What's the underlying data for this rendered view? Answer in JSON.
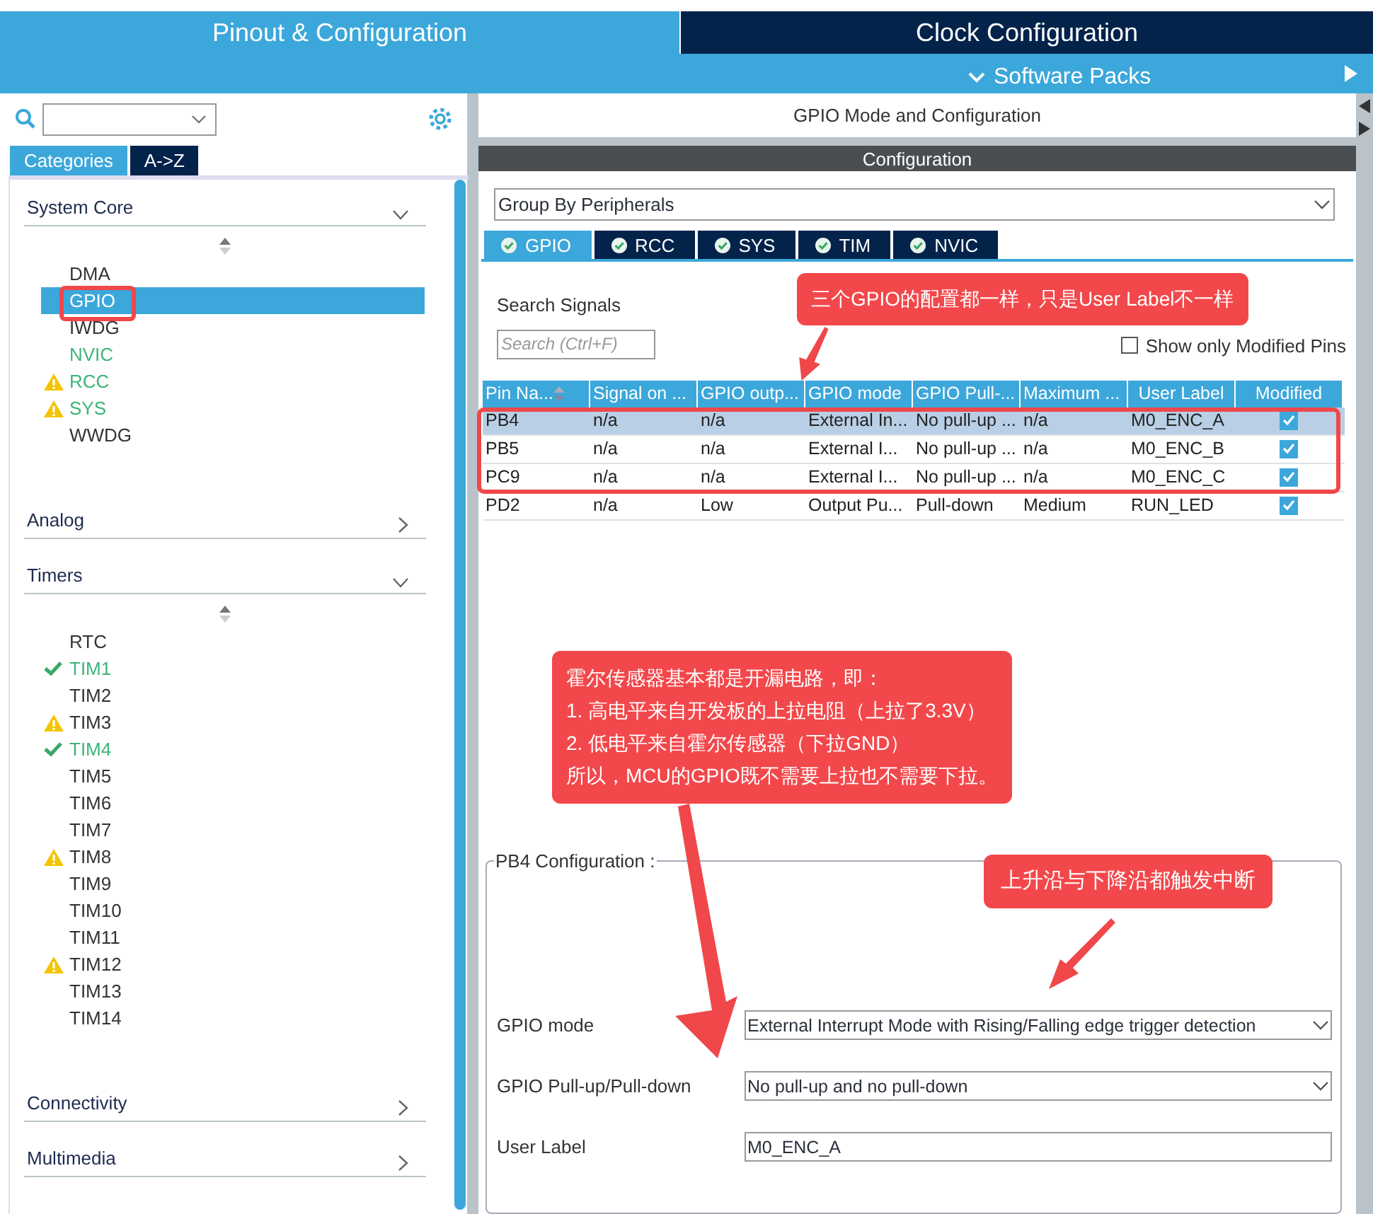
{
  "top_tabs": [
    {
      "label": "Pinout & Configuration",
      "selected": true
    },
    {
      "label": "Clock Configuration",
      "selected": false
    }
  ],
  "toolbar": {
    "menu": "Software Packs"
  },
  "sidebar": {
    "tabs": [
      {
        "label": "Categories",
        "selected": true
      },
      {
        "label": "A->Z",
        "selected": false
      }
    ],
    "categories": [
      {
        "label": "System Core",
        "expanded": true,
        "items": [
          {
            "label": "DMA",
            "kind": "plain",
            "enabled": false,
            "selected": false
          },
          {
            "label": "GPIO",
            "kind": "plain",
            "enabled": false,
            "selected": true
          },
          {
            "label": "IWDG",
            "kind": "plain",
            "enabled": false,
            "selected": false
          },
          {
            "label": "NVIC",
            "kind": "plain",
            "enabled": true,
            "selected": false
          },
          {
            "label": "RCC",
            "kind": "warning",
            "enabled": true,
            "selected": false
          },
          {
            "label": "SYS",
            "kind": "warning",
            "enabled": true,
            "selected": false
          },
          {
            "label": "WWDG",
            "kind": "plain",
            "enabled": false,
            "selected": false
          }
        ]
      },
      {
        "label": "Analog",
        "expanded": false
      },
      {
        "label": "Timers",
        "expanded": true,
        "items": [
          {
            "label": "RTC",
            "kind": "plain",
            "enabled": false,
            "selected": false
          },
          {
            "label": "TIM1",
            "kind": "ok",
            "enabled": true,
            "selected": false
          },
          {
            "label": "TIM2",
            "kind": "plain",
            "enabled": false,
            "selected": false
          },
          {
            "label": "TIM3",
            "kind": "warning",
            "enabled": false,
            "selected": false
          },
          {
            "label": "TIM4",
            "kind": "ok",
            "enabled": true,
            "selected": false
          },
          {
            "label": "TIM5",
            "kind": "plain",
            "enabled": false,
            "selected": false
          },
          {
            "label": "TIM6",
            "kind": "plain",
            "enabled": false,
            "selected": false
          },
          {
            "label": "TIM7",
            "kind": "plain",
            "enabled": false,
            "selected": false
          },
          {
            "label": "TIM8",
            "kind": "warning",
            "enabled": false,
            "selected": false
          },
          {
            "label": "TIM9",
            "kind": "plain",
            "enabled": false,
            "selected": false
          },
          {
            "label": "TIM10",
            "kind": "plain",
            "enabled": false,
            "selected": false
          },
          {
            "label": "TIM11",
            "kind": "plain",
            "enabled": false,
            "selected": false
          },
          {
            "label": "TIM12",
            "kind": "warning",
            "enabled": false,
            "selected": false
          },
          {
            "label": "TIM13",
            "kind": "plain",
            "enabled": false,
            "selected": false
          },
          {
            "label": "TIM14",
            "kind": "plain",
            "enabled": false,
            "selected": false
          }
        ]
      },
      {
        "label": "Connectivity",
        "expanded": false
      },
      {
        "label": "Multimedia",
        "expanded": false
      }
    ]
  },
  "main": {
    "title": "GPIO Mode and Configuration",
    "config_title": "Configuration",
    "group_by": "Group By Peripherals",
    "tabs": [
      {
        "label": "GPIO",
        "selected": true
      },
      {
        "label": "RCC",
        "selected": false
      },
      {
        "label": "SYS",
        "selected": false
      },
      {
        "label": "TIM",
        "selected": false
      },
      {
        "label": "NVIC",
        "selected": false
      }
    ],
    "search_label": "Search Signals",
    "search": {
      "placeholder": "Search (Ctrl+F)"
    },
    "show_modified": {
      "label": "Show only Modified Pins",
      "checked": false
    },
    "table": {
      "columns": [
        "Pin Na...",
        "Signal on ...",
        "GPIO outp...",
        "GPIO mode",
        "GPIO Pull-...",
        "Maximum ...",
        "User Label",
        "Modified"
      ],
      "rows": [
        {
          "cells": [
            "PB4",
            "n/a",
            "n/a",
            "External In...",
            "No pull-up ...",
            "n/a",
            "M0_ENC_A"
          ],
          "modified": true,
          "selected": true
        },
        {
          "cells": [
            "PB5",
            "n/a",
            "n/a",
            "External I...",
            "No pull-up ...",
            "n/a",
            "M0_ENC_B"
          ],
          "modified": true,
          "selected": false
        },
        {
          "cells": [
            "PC9",
            "n/a",
            "n/a",
            "External I...",
            "No pull-up ...",
            "n/a",
            "M0_ENC_C"
          ],
          "modified": true,
          "selected": false
        },
        {
          "cells": [
            "PD2",
            "n/a",
            "Low",
            "Output Pu...",
            "Pull-down",
            "Medium",
            "RUN_LED"
          ],
          "modified": true,
          "selected": false
        }
      ]
    },
    "pin_config": {
      "title": "PB4 Configuration :",
      "fields": [
        {
          "label": "GPIO mode",
          "kind": "select",
          "value": "External Interrupt Mode with Rising/Falling edge trigger detection"
        },
        {
          "label": "GPIO Pull-up/Pull-down",
          "kind": "select",
          "value": "No pull-up and no pull-down"
        },
        {
          "label": "User Label",
          "kind": "text",
          "value": "M0_ENC_A"
        }
      ]
    }
  },
  "annotations": [
    {
      "lines": [
        "三个GPIO的配置都一样，只是User Label不一样"
      ]
    },
    {
      "lines": [
        "霍尔传感器基本都是开漏电路，即：",
        "1. 高电平来自开发板的上拉电阻（上拉了3.3V）",
        "2. 低电平来自霍尔传感器（下拉GND）",
        "所以，MCU的GPIO既不需要上拉也不需要下拉。"
      ]
    },
    {
      "lines": [
        "上升沿与下降沿都触发中断"
      ]
    }
  ]
}
